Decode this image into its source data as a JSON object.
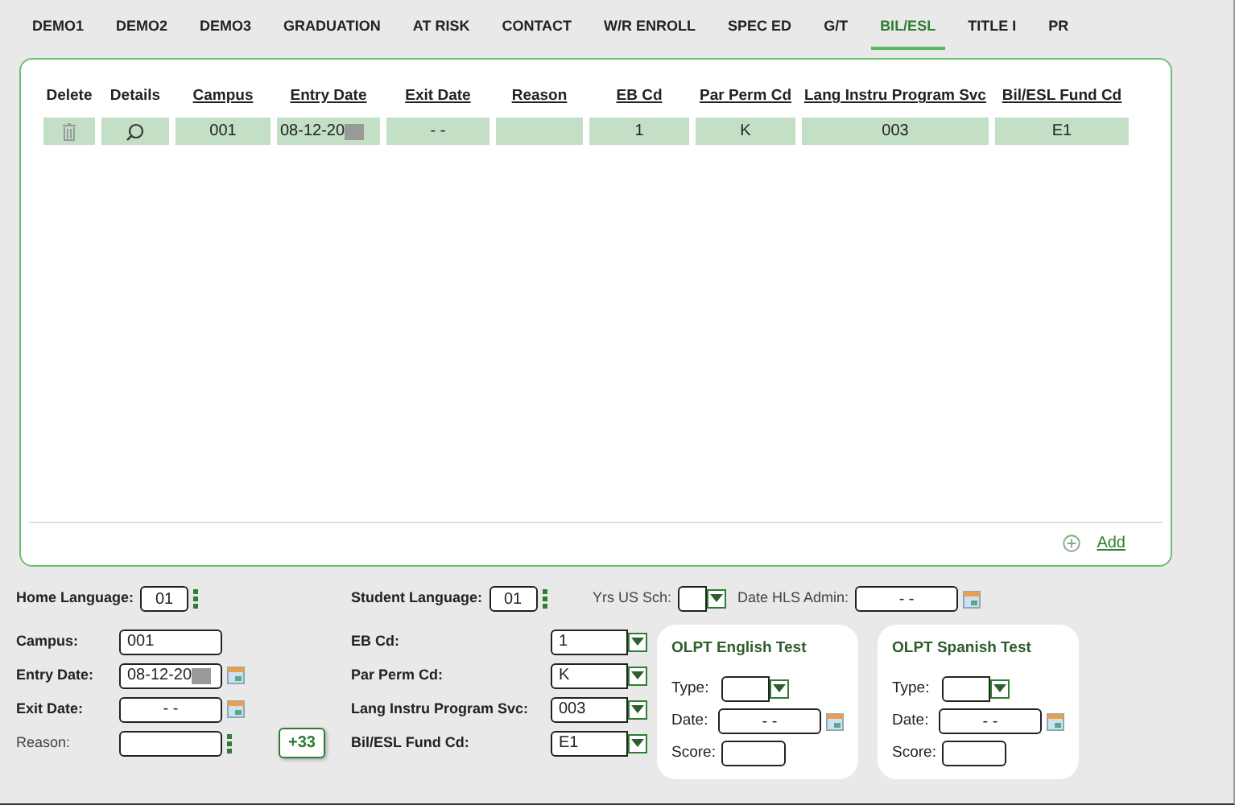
{
  "tabs": [
    {
      "label": "DEMO1",
      "selected": false
    },
    {
      "label": "DEMO2",
      "selected": false
    },
    {
      "label": "DEMO3",
      "selected": false
    },
    {
      "label": "GRADUATION",
      "selected": false
    },
    {
      "label": "AT RISK",
      "selected": false
    },
    {
      "label": "CONTACT",
      "selected": false
    },
    {
      "label": "W/R ENROLL",
      "selected": false
    },
    {
      "label": "SPEC ED",
      "selected": false
    },
    {
      "label": "G/T",
      "selected": false
    },
    {
      "label": "BIL/ESL",
      "selected": true
    },
    {
      "label": "TITLE I",
      "selected": false
    },
    {
      "label": "PR",
      "selected": false
    }
  ],
  "table": {
    "columns": [
      {
        "label": "Delete",
        "kind": "delete",
        "sortable": false
      },
      {
        "label": "Details",
        "kind": "details",
        "sortable": false
      },
      {
        "label": "Campus",
        "kind": "text",
        "sortable": true
      },
      {
        "label": "Entry Date",
        "kind": "text",
        "sortable": true
      },
      {
        "label": "Exit Date",
        "kind": "text",
        "sortable": true
      },
      {
        "label": "Reason",
        "kind": "text",
        "sortable": true
      },
      {
        "label": "EB Cd",
        "kind": "text",
        "sortable": true
      },
      {
        "label": "Par Perm Cd",
        "kind": "text",
        "sortable": true
      },
      {
        "label": "Lang Instru Program Svc",
        "kind": "text",
        "sortable": true
      },
      {
        "label": "Bil/ESL Fund Cd",
        "kind": "text",
        "sortable": true
      }
    ],
    "rows": [
      {
        "cells": [
          {},
          {},
          {
            "text": "001"
          },
          {
            "text": "08-12-20",
            "redacted": true
          },
          {
            "text": "- -"
          },
          {},
          {
            "text": "1"
          },
          {
            "text": "K"
          },
          {
            "text": "003"
          },
          {
            "text": "E1"
          }
        ]
      }
    ]
  },
  "add_link": "Add",
  "top_fields": [
    {
      "label": "Home Language:",
      "value": "01",
      "kind": "lookup"
    },
    {
      "label": "Student Language:",
      "value": "01",
      "kind": "lookup"
    },
    {
      "label": "Yrs US Sch:",
      "kind": "select"
    },
    {
      "label": "Date HLS Admin:",
      "value": "- -",
      "kind": "date"
    }
  ],
  "left_fields": [
    {
      "label": "Campus:",
      "value": "001",
      "kind": "text"
    },
    {
      "label": "Entry Date:",
      "value": "08-12-20",
      "kind": "date",
      "redacted": true
    },
    {
      "label": "Exit Date:",
      "value": "- -",
      "kind": "date"
    },
    {
      "label": "Reason:",
      "kind": "lookup",
      "muted": true
    }
  ],
  "more_button": "+33",
  "select_fields": [
    {
      "label": "EB Cd:",
      "value": "1"
    },
    {
      "label": "Par Perm Cd:",
      "value": "K"
    },
    {
      "label": "Lang Instru Program Svc:",
      "value": "003"
    },
    {
      "label": "Bil/ESL Fund Cd:",
      "value": "E1"
    }
  ],
  "tests": [
    {
      "title": "OLPT English Test",
      "fields": [
        {
          "label": "Type:",
          "kind": "select"
        },
        {
          "label": "Date:",
          "value": "- -",
          "kind": "date"
        },
        {
          "label": "Score:",
          "kind": "text"
        }
      ]
    },
    {
      "title": "OLPT Spanish Test",
      "fields": [
        {
          "label": "Type:",
          "kind": "select"
        },
        {
          "label": "Date:",
          "value": "- -",
          "kind": "date"
        },
        {
          "label": "Score:",
          "kind": "text"
        }
      ]
    }
  ]
}
